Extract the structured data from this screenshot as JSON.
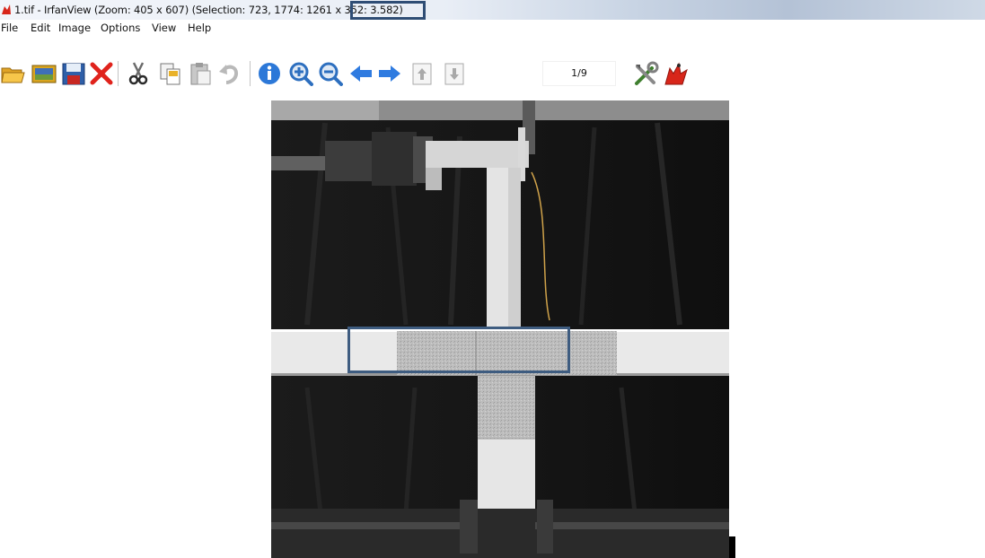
{
  "window": {
    "title": "1.tif - IrfanView (Zoom: 405 x 607) (Selection: 723, 1774: 1261 x 352: 3.582)"
  },
  "menu": {
    "items": [
      "File",
      "Edit",
      "Image",
      "Options",
      "View",
      "Help"
    ]
  },
  "toolbar": {
    "icons": [
      "open-folder-icon",
      "thumbnails-icon",
      "save-icon",
      "delete-icon",
      "cut-icon",
      "copy-icon",
      "paste-icon",
      "undo-icon",
      "info-icon",
      "zoom-in-icon",
      "zoom-out-icon",
      "previous-icon",
      "next-icon",
      "first-page-icon",
      "last-page-icon",
      "settings-icon",
      "irfanview-logo-icon"
    ],
    "page_counter": "1/9"
  },
  "image": {
    "subject": "grayscale photo of a white T-shaped test specimen with a hydraulic actuator against a dark backdrop"
  },
  "colors": {
    "highlight_border": "#2f4d75",
    "delete_red": "#e0231c",
    "arrow_blue": "#2f7be0"
  }
}
